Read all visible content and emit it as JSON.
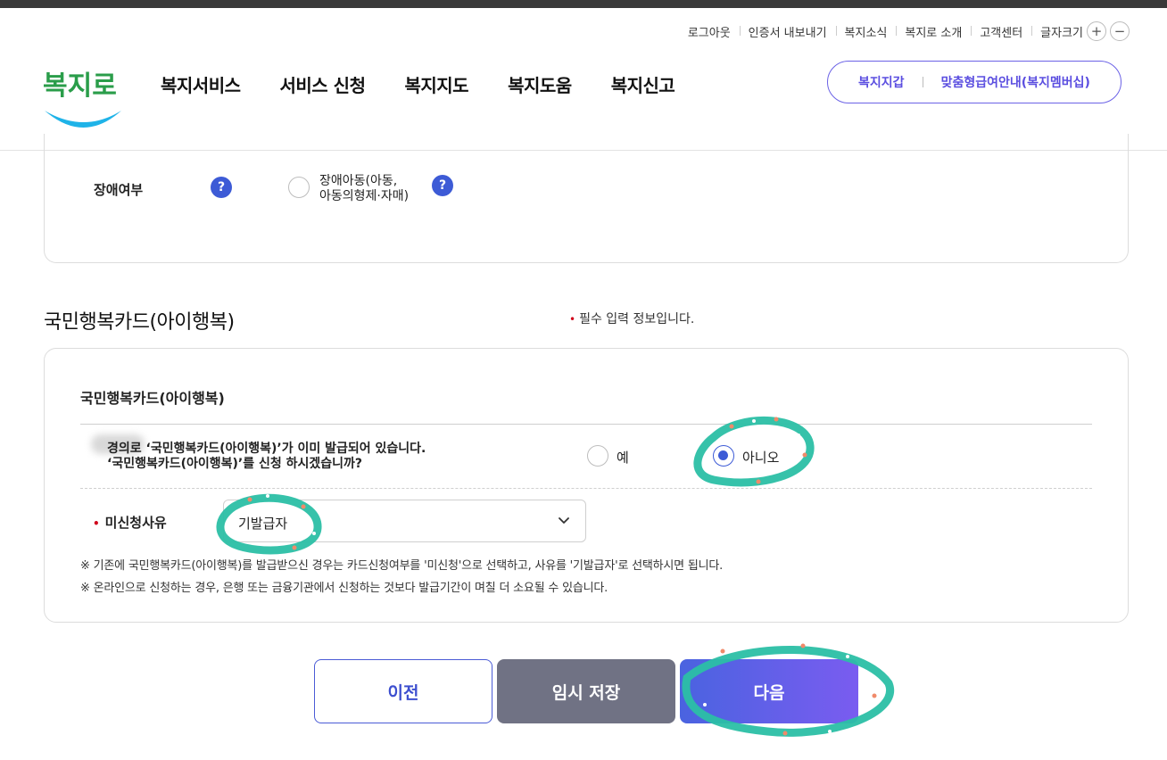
{
  "utility_bar": {
    "items": [
      "로그아웃",
      "인증서 내보내기",
      "복지소식",
      "복지로 소개",
      "고객센터",
      "글자크기"
    ],
    "font_increase": "+",
    "font_decrease": "−"
  },
  "logo_text": "복지로",
  "gnb": {
    "items": [
      "복지서비스",
      "서비스 신청",
      "복지지도",
      "복지도움",
      "복지신고"
    ]
  },
  "quick": {
    "wallet": "복지지갑",
    "membership": "맞춤형급여안내(복지멤버십)"
  },
  "disability": {
    "label": "장애여부",
    "help": "?",
    "option_line1": "장애아동(아동,",
    "option_line2": "아동의형제·자매)"
  },
  "section": {
    "title": "국민행복카드(아이행복)",
    "required_note": "필수 입력 정보입니다.",
    "required_mark": "•"
  },
  "card": {
    "title": "국민행복카드(아이행복)",
    "question_line1": "경의로 ‘국민행복카드(아이행복)’가 이미 발급되어 있습니다.",
    "question_line2": "‘국민행복카드(아이행복)’를 신청 하시겠습니까?",
    "options": [
      {
        "label": "예",
        "selected": false
      },
      {
        "label": "아니오",
        "selected": true
      }
    ],
    "reason_label": "미신청사유",
    "reason_value": "기발급자",
    "notes": [
      "※ 기존에 국민행복카드(아이행복)를 발급받으신 경우는 카드신청여부를 '미신청'으로 선택하고, 사유를 '기발급자'로 선택하시면 됩니다.",
      "※ 온라인으로 신청하는 경우, 은행 또는 금융기관에서 신청하는 것보다 발급기간이 며칠 더 소요될 수 있습니다."
    ]
  },
  "buttons": {
    "prev": "이전",
    "save": "임시 저장",
    "next": "다음"
  },
  "colors": {
    "accent": "#3d5bd6",
    "brand_purple": "#6b62e6",
    "annotation": "#2bbfa5",
    "required": "#d0021b"
  }
}
